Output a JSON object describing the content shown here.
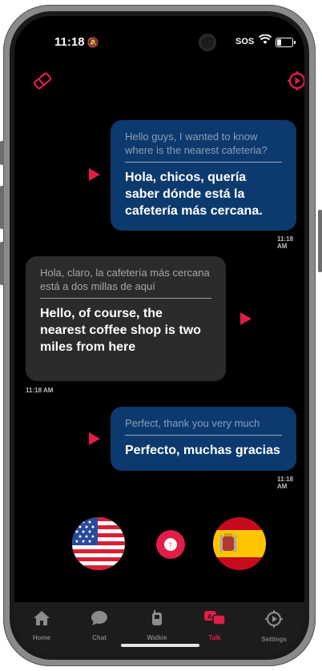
{
  "status": {
    "time": "11:18",
    "carrier": "SOS"
  },
  "messages": [
    {
      "original": "Hello guys, I wanted to know where is the nearest cafeteria?",
      "translation": "Hola, chicos, quería saber dónde está la cafetería más cercana.",
      "time": "11:18 AM"
    },
    {
      "original": "Hola, claro, la cafetería más cercana está a dos millas de aquí",
      "translation": "Hello, of course, the nearest coffee shop is two miles from here",
      "time": "11:18 AM"
    },
    {
      "original": "Perfect, thank you very much",
      "translation": "Perfecto, muchas gracias",
      "time": "11:18 AM"
    }
  ],
  "languages": {
    "left": "English (US flag)",
    "right": "Spanish (Spain flag)"
  },
  "tabs": [
    {
      "label": "Home",
      "icon": "home-icon"
    },
    {
      "label": "Chat",
      "icon": "chat-icon"
    },
    {
      "label": "Walkie",
      "icon": "walkie-icon"
    },
    {
      "label": "Talk",
      "icon": "talk-icon"
    },
    {
      "label": "Settings",
      "icon": "settings-icon"
    }
  ],
  "active_tab": "Talk",
  "colors": {
    "accent": "#e11d48",
    "bubble_outgoing": "#0d3a6e",
    "bubble_incoming": "#2b2b2b",
    "background": "#000000"
  }
}
